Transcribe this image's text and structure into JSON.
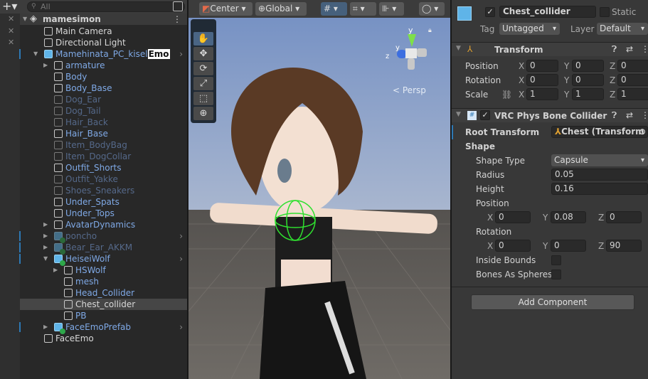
{
  "hierarchy": {
    "search_placeholder": "All",
    "scene": "mamesimon",
    "items": [
      {
        "label": "Main Camera",
        "depth": 1
      },
      {
        "label": "Directional Light",
        "depth": 1
      },
      {
        "label": "Mamehinata_PC_kisel",
        "highlight": "Emo",
        "depth": 1
      },
      {
        "label": "armature",
        "depth": 2
      },
      {
        "label": "Body",
        "depth": 2
      },
      {
        "label": "Body_Base",
        "depth": 2
      },
      {
        "label": "Dog_Ear",
        "depth": 2
      },
      {
        "label": "Dog_Tail",
        "depth": 2
      },
      {
        "label": "Hair_Back",
        "depth": 2
      },
      {
        "label": "Hair_Base",
        "depth": 2
      },
      {
        "label": "Item_BodyBag",
        "depth": 2
      },
      {
        "label": "Item_DogCollar",
        "depth": 2
      },
      {
        "label": "Outfit_Shorts",
        "depth": 2
      },
      {
        "label": "Outfit_Yakke",
        "depth": 2
      },
      {
        "label": "Shoes_Sneakers",
        "depth": 2
      },
      {
        "label": "Under_Spats",
        "depth": 2
      },
      {
        "label": "Under_Tops",
        "depth": 2
      },
      {
        "label": "AvatarDynamics",
        "depth": 2
      },
      {
        "label": "poncho",
        "depth": 2
      },
      {
        "label": "Bear_Ear_AKKM",
        "depth": 2
      },
      {
        "label": "HeiseiWolf",
        "depth": 2
      },
      {
        "label": "HSWolf",
        "depth": 3
      },
      {
        "label": "mesh",
        "depth": 3
      },
      {
        "label": "Head_Collider",
        "depth": 3
      },
      {
        "label": "Chest_collider",
        "depth": 3
      },
      {
        "label": "PB",
        "depth": 3
      },
      {
        "label": "FaceEmoPrefab",
        "depth": 2
      },
      {
        "label": "FaceEmo",
        "depth": 1
      }
    ]
  },
  "scene_view": {
    "pivot": "Center",
    "space": "Global",
    "persp": "Persp",
    "gizmo_axes": {
      "y": "y",
      "z": "z",
      "y2": "y"
    }
  },
  "inspector": {
    "object_name": "Chest_collider",
    "static_label": "Static",
    "tag_label": "Tag",
    "tag": "Untagged",
    "layer_label": "Layer",
    "layer": "Default",
    "transform": {
      "title": "Transform",
      "position_label": "Position",
      "position": [
        "0",
        "0",
        "0"
      ],
      "rotation_label": "Rotation",
      "rotation": [
        "0",
        "0",
        "0"
      ],
      "scale_label": "Scale",
      "scale": [
        "1",
        "1",
        "1"
      ]
    },
    "collider": {
      "title": "VRC Phys Bone Collider (Sc",
      "root_transform_label": "Root Transform",
      "root_transform": "Chest (Transform",
      "shape_label": "Shape",
      "shape_type_label": "Shape Type",
      "shape_type": "Capsule",
      "radius_label": "Radius",
      "radius": "0.05",
      "height_label": "Height",
      "height": "0.16",
      "position_label": "Position",
      "position": [
        "0",
        "0.08",
        "0"
      ],
      "rotation_label": "Rotation",
      "rotation": [
        "0",
        "0",
        "90"
      ],
      "inside_bounds_label": "Inside Bounds",
      "inside_bounds": false,
      "bones_as_spheres_label": "Bones As Spheres",
      "bones_as_spheres": false
    },
    "axis": [
      "X",
      "Y",
      "Z"
    ],
    "add_component": "Add Component"
  }
}
